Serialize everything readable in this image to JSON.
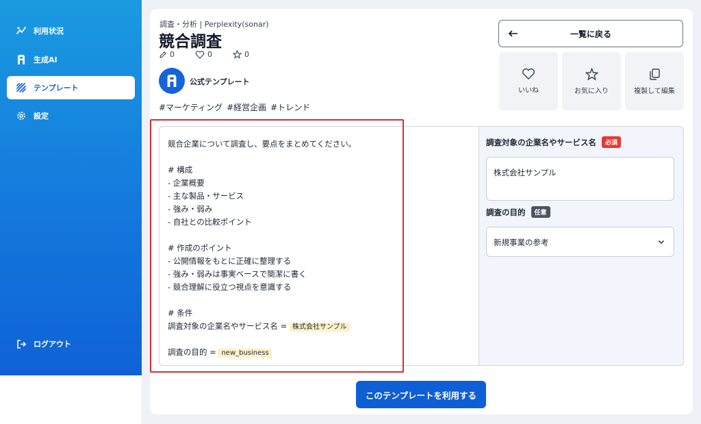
{
  "sidebar": {
    "items": [
      {
        "label": "利用状況",
        "icon": "chart-icon"
      },
      {
        "label": "生成AI",
        "icon": "ai-logo-icon"
      },
      {
        "label": "テンプレート",
        "icon": "template-icon"
      },
      {
        "label": "設定",
        "icon": "gear-icon"
      }
    ],
    "logout_label": "ログアウト"
  },
  "header": {
    "category": "調査・分析 | Perplexity(sonar)",
    "title": "競合調査",
    "stats": {
      "edits": "0",
      "likes": "0",
      "favorites": "0"
    },
    "author": "公式テンプレート",
    "tags": [
      "#マーケティング",
      "#経営企画",
      "#トレンド"
    ]
  },
  "actions": {
    "back_label": "一覧に戻る",
    "like_label": "いいね",
    "favorite_label": "お気に入り",
    "duplicate_label": "複製して編集"
  },
  "prompt": {
    "lines": [
      "競合企業について調査し、要点をまとめてください。",
      "",
      "# 構成",
      "- 企業概要",
      "- 主な製品・サービス",
      "- 強み・弱み",
      "- 自社との比較ポイント",
      "",
      "# 作成のポイント",
      "- 公開情報をもとに正確に整理する",
      "- 強み・弱みは事実ベースで簡潔に書く",
      "- 競合理解に役立つ視点を意識する",
      "",
      "# 条件"
    ],
    "var1_label": "調査対象の企業名やサービス名 = ",
    "var1_value": "株式会社サンプル",
    "var2_label": "調査の目的 = ",
    "var2_value": "new_business"
  },
  "form": {
    "field1_label": "調査対象の企業名やサービス名",
    "field1_badge": "必須",
    "field1_value": "株式会社サンプル",
    "field2_label": "調査の目的",
    "field2_badge": "任意",
    "field2_value": "新規事業の参考"
  },
  "use_button_label": "このテンプレートを利用する",
  "colors": {
    "primary": "#0e5ed6",
    "required": "#e53935",
    "highlight_border": "#d32f2f"
  }
}
